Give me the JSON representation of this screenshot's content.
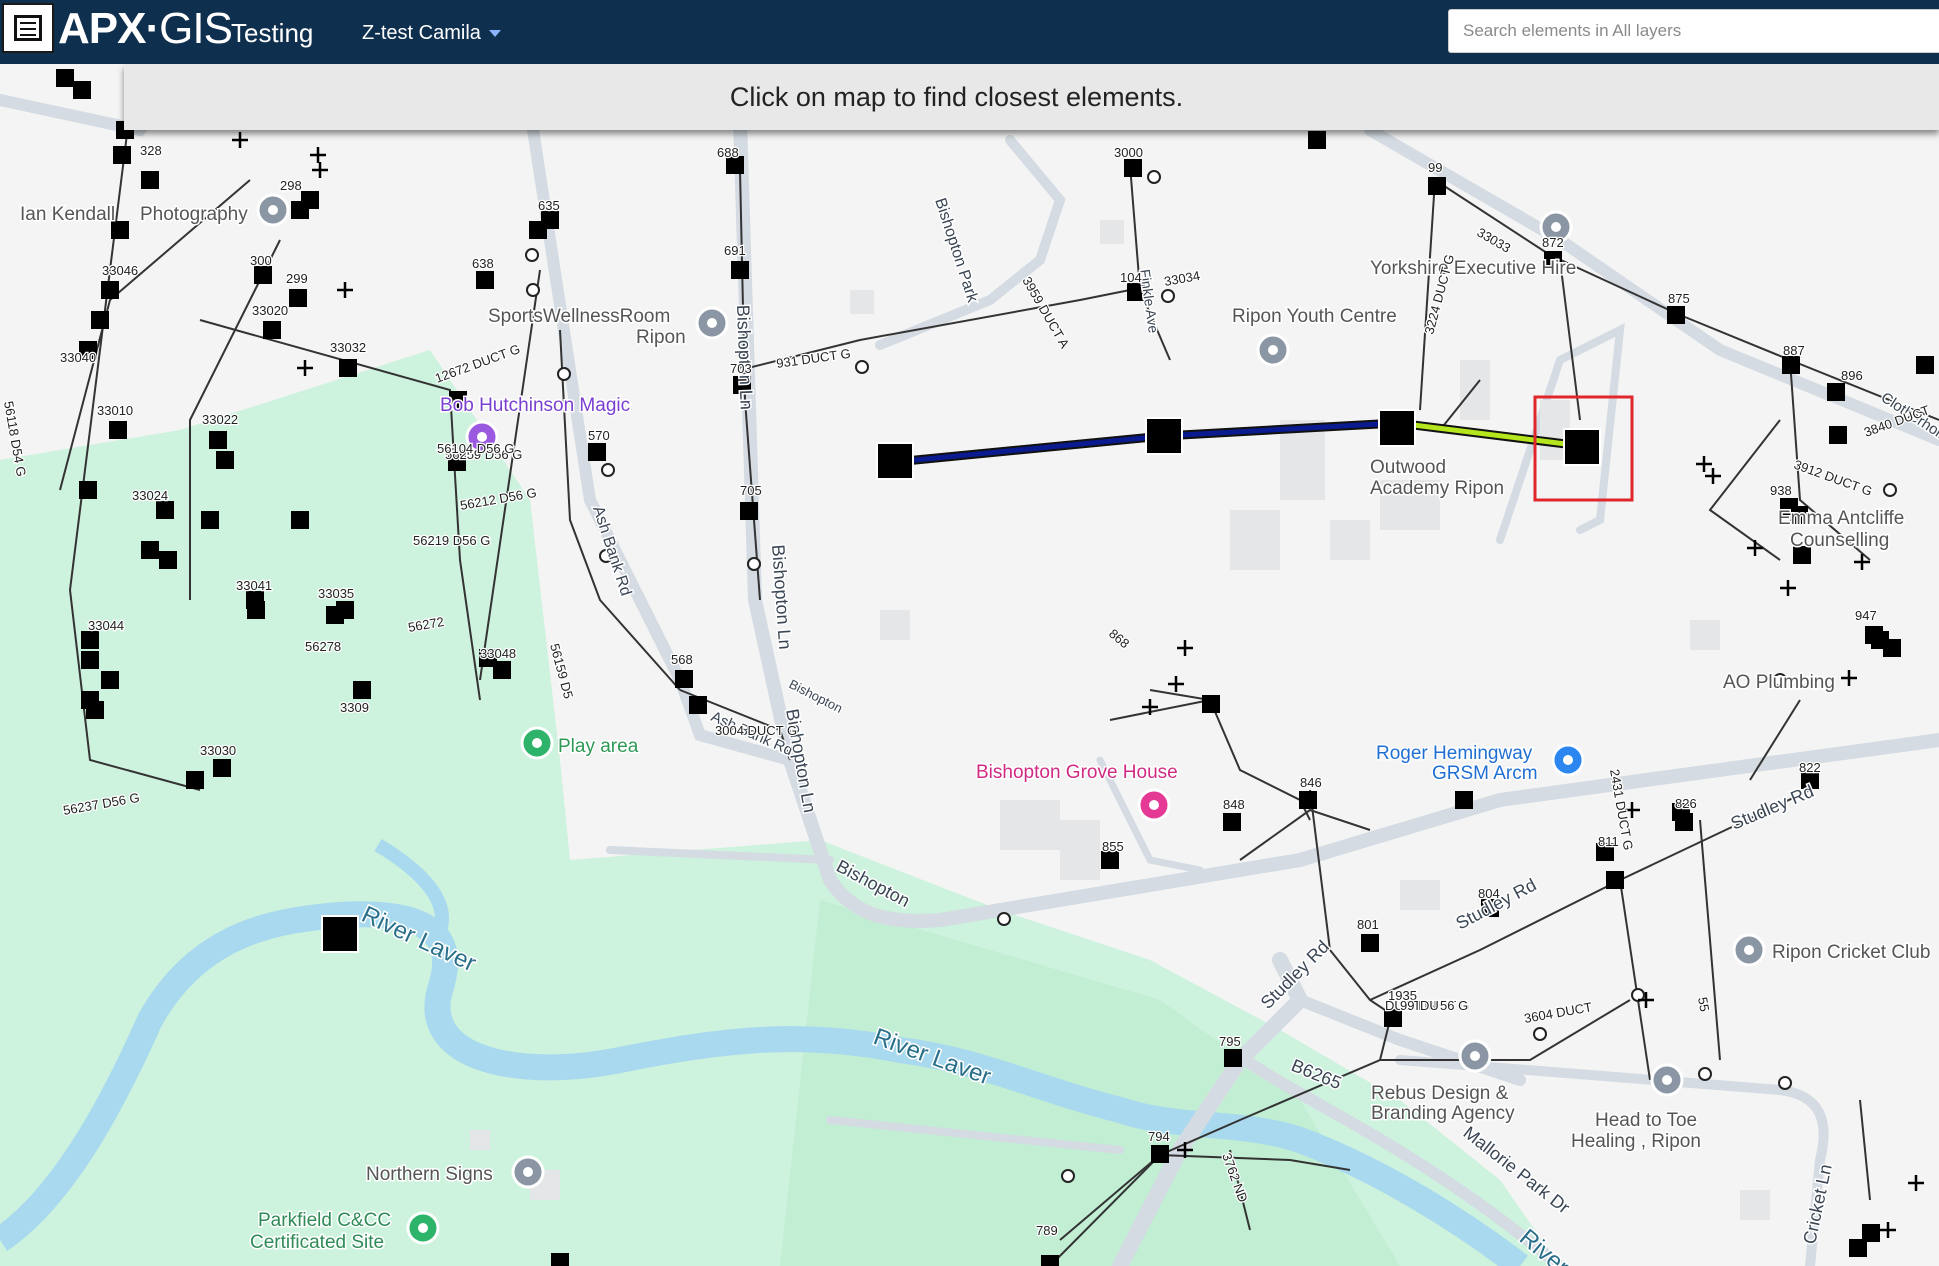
{
  "app": {
    "logo_main": "APX",
    "logo_dot": "·",
    "logo_gis": "GIS",
    "environment": "Testing",
    "project_selector": "Z-test Camila"
  },
  "search": {
    "placeholder": "Search elements in All layers"
  },
  "banner": {
    "message": "Click on map to find closest elements."
  },
  "colors": {
    "topbar": "#0f2f4f",
    "selected_line": "#0a1a8f",
    "highlight_line": "#b5e61d",
    "selection_box": "#e0262b",
    "water": "#a9d9ee",
    "park": "#c8f0d8"
  },
  "map": {
    "places": [
      {
        "name": "Ian Kendall",
        "icon": "camera-pin"
      },
      {
        "name": "Photography",
        "icon": ""
      },
      {
        "name": "SportsWellnessRoom",
        "icon": "pin"
      },
      {
        "name": "Ripon",
        "icon": ""
      },
      {
        "name": "Bob Hutchinson Magic",
        "icon": "purple-pin"
      },
      {
        "name": "Yorkshire Executive Hire",
        "icon": "pin"
      },
      {
        "name": "Ripon Youth Centre",
        "icon": "pin"
      },
      {
        "name": "Outwood",
        "icon": ""
      },
      {
        "name": "Academy Ripon",
        "icon": ""
      },
      {
        "name": "Emma Antcliffe",
        "icon": ""
      },
      {
        "name": "Counselling",
        "icon": ""
      },
      {
        "name": "AO Plumbing",
        "icon": ""
      },
      {
        "name": "Play area",
        "icon": "tree-pin"
      },
      {
        "name": "Bishopton Grove House",
        "icon": "hotel-pin"
      },
      {
        "name": "Roger Hemingway",
        "icon": "lock-pin"
      },
      {
        "name": "GRSM Arcm",
        "icon": ""
      },
      {
        "name": "Ripon Cricket Club",
        "icon": "pin"
      },
      {
        "name": "Rebus Design &",
        "icon": "pin"
      },
      {
        "name": "Branding Agency",
        "icon": ""
      },
      {
        "name": "Head to Toe",
        "icon": "pin"
      },
      {
        "name": "Healing , Ripon",
        "icon": ""
      },
      {
        "name": "Northern Signs",
        "icon": "pin"
      },
      {
        "name": "Parkfield C&CC",
        "icon": "green-pin"
      },
      {
        "name": "Certificated Site",
        "icon": ""
      }
    ],
    "roads": [
      "Bishopton Park",
      "Bishopton Ln",
      "Bishopton Ln",
      "Ash Bank Rd",
      "Bishopton",
      "Studley Rd",
      "Studley Rd",
      "Studley Rd",
      "B6265",
      "Mallorie Park Dr",
      "Cricket Ln",
      "Bishopton",
      "Ash Bank Rd",
      "Bishopton Ln",
      "Finkle Ave",
      "Clotherholme"
    ],
    "water_labels": [
      "River Laver",
      "River Laver",
      "River"
    ],
    "network_labels": [
      "328",
      "298",
      "300",
      "299",
      "33046",
      "33020",
      "33040",
      "33032",
      "33010",
      "33022",
      "33024",
      "33041",
      "33035",
      "33044",
      "33048",
      "3309",
      "33030",
      "635",
      "638",
      "688",
      "691",
      "703",
      "705",
      "570",
      "568",
      "3000",
      "104",
      "931 DUCT G",
      "3959 DUCT A",
      "3224 DUCT G",
      "99",
      "872",
      "875",
      "887",
      "896",
      "3840 DUCT",
      "3912 DUCT G",
      "938",
      "947",
      "822",
      "826",
      "811",
      "804",
      "801",
      "795",
      "794",
      "789",
      "855",
      "848",
      "846",
      "868",
      "1935",
      "55",
      "3762 ND",
      "2431 DUCT G",
      "12672 DUCT G",
      "56259 D56 G",
      "56212 D56 G",
      "56219 D56 G",
      "56272",
      "56278",
      "56159 D5",
      "56237 D56 G",
      "56118 D54 G",
      "56104 D56 G",
      "33033",
      "33034",
      "3604 DUCT",
      "3004 DUCT G",
      "DUCT G",
      "99 DU",
      "DUCT G",
      "56 G",
      "D56 G",
      "D56 G",
      "D56 G"
    ]
  }
}
